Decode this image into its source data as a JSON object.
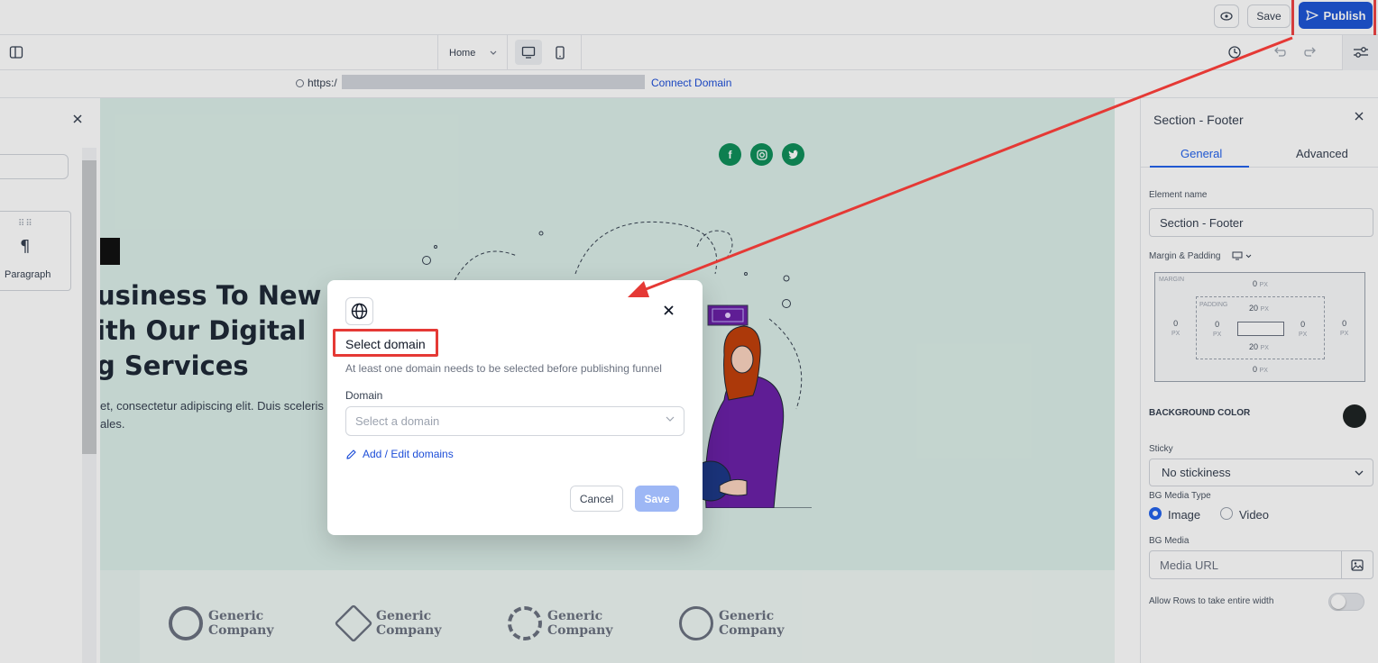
{
  "topbar": {
    "save_label": "Save",
    "publish_label": "Publish"
  },
  "toolbar": {
    "page_select": "Home"
  },
  "urlbar": {
    "url_prefix": "https:/",
    "connect_domain_label": "Connect Domain"
  },
  "left_panel": {
    "paragraph_label": "Paragraph"
  },
  "canvas": {
    "hero_title_lines": [
      "usiness To New",
      "ith Our Digital",
      "g Services"
    ],
    "hero_sub_lines": [
      "et, consectetur adipiscing elit. Duis sceleris",
      "ales."
    ],
    "logos": [
      {
        "line1": "Generic",
        "line2": "Company"
      },
      {
        "line1": "Generic",
        "line2": "Company"
      },
      {
        "line1": "Generic",
        "line2": "Company"
      },
      {
        "line1": "Generic",
        "line2": "Company"
      }
    ]
  },
  "right_panel": {
    "title": "Section - Footer",
    "tab_general": "General",
    "tab_advanced": "Advanced",
    "element_name_label": "Element name",
    "element_name_value": "Section - Footer",
    "margin_padding_label": "Margin & Padding",
    "margin_label": "MARGIN",
    "padding_label": "PADDING",
    "margin_top": "0",
    "margin_bottom": "0",
    "margin_left": "0",
    "margin_right": "0",
    "padding_top": "20",
    "padding_bottom": "20",
    "padding_left": "0",
    "padding_right": "0",
    "unit": "PX",
    "bg_color_label": "BACKGROUND COLOR",
    "bg_color": "#1f2424",
    "sticky_label": "Sticky",
    "sticky_value": "No stickiness",
    "bg_media_type_label": "BG Media Type",
    "media_image": "Image",
    "media_video": "Video",
    "bg_media_label": "BG Media",
    "media_url_placeholder": "Media URL",
    "allow_rows_label": "Allow Rows to take entire width"
  },
  "modal": {
    "title": "Select domain",
    "description": "At least one domain needs to be selected before publishing funnel",
    "domain_label": "Domain",
    "select_placeholder": "Select a domain",
    "add_edit_link": "Add / Edit domains",
    "cancel_label": "Cancel",
    "save_label": "Save"
  },
  "colors": {
    "publish_blue": "#1e56d6",
    "annotation_red": "#e53935",
    "social_green": "#0f8f5a",
    "link_blue": "#1d4ed8"
  }
}
